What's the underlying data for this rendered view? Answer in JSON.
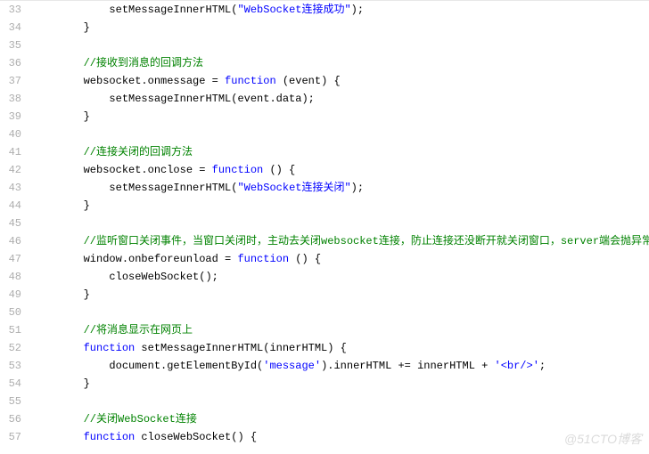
{
  "watermark": "@51CTO博客",
  "lines": [
    {
      "num": "33",
      "indent": 3,
      "segments": [
        {
          "cls": "plain",
          "t": "setMessageInnerHTML("
        },
        {
          "cls": "string",
          "t": "\"WebSocket连接成功\""
        },
        {
          "cls": "plain",
          "t": ");"
        }
      ]
    },
    {
      "num": "34",
      "indent": 2,
      "segments": [
        {
          "cls": "plain",
          "t": "}"
        }
      ]
    },
    {
      "num": "35",
      "indent": 0,
      "segments": []
    },
    {
      "num": "36",
      "indent": 2,
      "segments": [
        {
          "cls": "comment",
          "t": "//接收到消息的回调方法"
        }
      ]
    },
    {
      "num": "37",
      "indent": 2,
      "segments": [
        {
          "cls": "plain",
          "t": "websocket.onmessage = "
        },
        {
          "cls": "keyword",
          "t": "function"
        },
        {
          "cls": "plain",
          "t": " (event) {"
        }
      ]
    },
    {
      "num": "38",
      "indent": 3,
      "segments": [
        {
          "cls": "plain",
          "t": "setMessageInnerHTML(event.data);"
        }
      ]
    },
    {
      "num": "39",
      "indent": 2,
      "segments": [
        {
          "cls": "plain",
          "t": "}"
        }
      ]
    },
    {
      "num": "40",
      "indent": 0,
      "segments": []
    },
    {
      "num": "41",
      "indent": 2,
      "segments": [
        {
          "cls": "comment",
          "t": "//连接关闭的回调方法"
        }
      ]
    },
    {
      "num": "42",
      "indent": 2,
      "segments": [
        {
          "cls": "plain",
          "t": "websocket.onclose = "
        },
        {
          "cls": "keyword",
          "t": "function"
        },
        {
          "cls": "plain",
          "t": " () {"
        }
      ]
    },
    {
      "num": "43",
      "indent": 3,
      "segments": [
        {
          "cls": "plain",
          "t": "setMessageInnerHTML("
        },
        {
          "cls": "string",
          "t": "\"WebSocket连接关闭\""
        },
        {
          "cls": "plain",
          "t": ");"
        }
      ]
    },
    {
      "num": "44",
      "indent": 2,
      "segments": [
        {
          "cls": "plain",
          "t": "}"
        }
      ]
    },
    {
      "num": "45",
      "indent": 0,
      "segments": []
    },
    {
      "num": "46",
      "indent": 2,
      "segments": [
        {
          "cls": "comment",
          "t": "//监听窗口关闭事件，当窗口关闭时，主动去关闭websocket连接，防止连接还没断开就关闭窗口，server端会抛异常。"
        }
      ]
    },
    {
      "num": "47",
      "indent": 2,
      "segments": [
        {
          "cls": "plain",
          "t": "window.onbeforeunload = "
        },
        {
          "cls": "keyword",
          "t": "function"
        },
        {
          "cls": "plain",
          "t": " () {"
        }
      ]
    },
    {
      "num": "48",
      "indent": 3,
      "segments": [
        {
          "cls": "plain",
          "t": "closeWebSocket();"
        }
      ]
    },
    {
      "num": "49",
      "indent": 2,
      "segments": [
        {
          "cls": "plain",
          "t": "}"
        }
      ]
    },
    {
      "num": "50",
      "indent": 0,
      "segments": []
    },
    {
      "num": "51",
      "indent": 2,
      "segments": [
        {
          "cls": "comment",
          "t": "//将消息显示在网页上"
        }
      ]
    },
    {
      "num": "52",
      "indent": 2,
      "segments": [
        {
          "cls": "keyword",
          "t": "function"
        },
        {
          "cls": "plain",
          "t": " setMessageInnerHTML(innerHTML) {"
        }
      ]
    },
    {
      "num": "53",
      "indent": 3,
      "segments": [
        {
          "cls": "plain",
          "t": "document.getElementById("
        },
        {
          "cls": "string",
          "t": "'message'"
        },
        {
          "cls": "plain",
          "t": ").innerHTML += innerHTML + "
        },
        {
          "cls": "string",
          "t": "'<br/>'"
        },
        {
          "cls": "plain",
          "t": ";"
        }
      ]
    },
    {
      "num": "54",
      "indent": 2,
      "segments": [
        {
          "cls": "plain",
          "t": "}"
        }
      ]
    },
    {
      "num": "55",
      "indent": 0,
      "segments": []
    },
    {
      "num": "56",
      "indent": 2,
      "segments": [
        {
          "cls": "comment",
          "t": "//关闭WebSocket连接"
        }
      ]
    },
    {
      "num": "57",
      "indent": 2,
      "segments": [
        {
          "cls": "keyword",
          "t": "function"
        },
        {
          "cls": "plain",
          "t": " closeWebSocket() {"
        }
      ]
    }
  ]
}
